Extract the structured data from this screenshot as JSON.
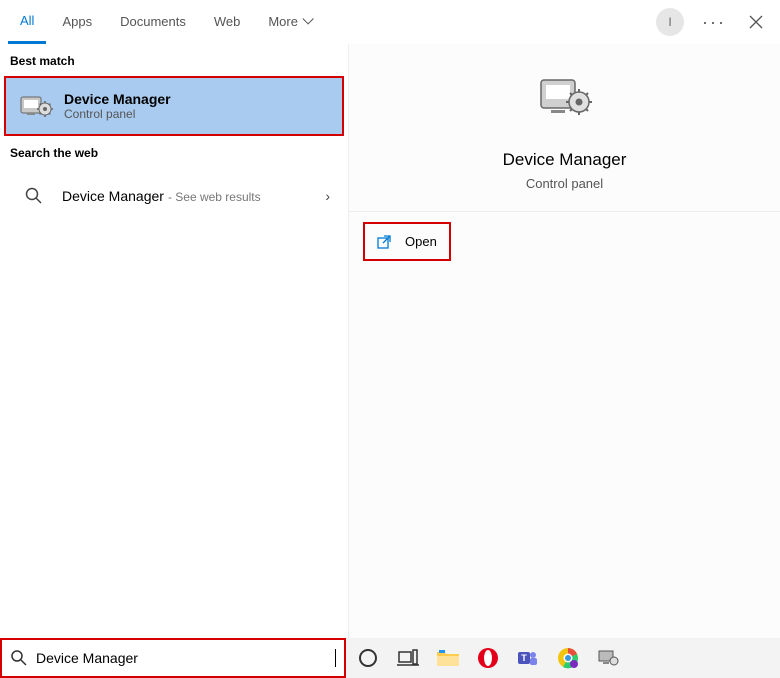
{
  "tabs": {
    "all": "All",
    "apps": "Apps",
    "documents": "Documents",
    "web": "Web",
    "more": "More"
  },
  "avatar_initial": "I",
  "left": {
    "best_match_label": "Best match",
    "result_title": "Device Manager",
    "result_sub": "Control panel",
    "web_label": "Search the web",
    "web_query": "Device Manager",
    "web_suffix": "- See web results"
  },
  "preview": {
    "title": "Device Manager",
    "sub": "Control panel",
    "open_label": "Open"
  },
  "search": {
    "value": "Device Manager"
  }
}
